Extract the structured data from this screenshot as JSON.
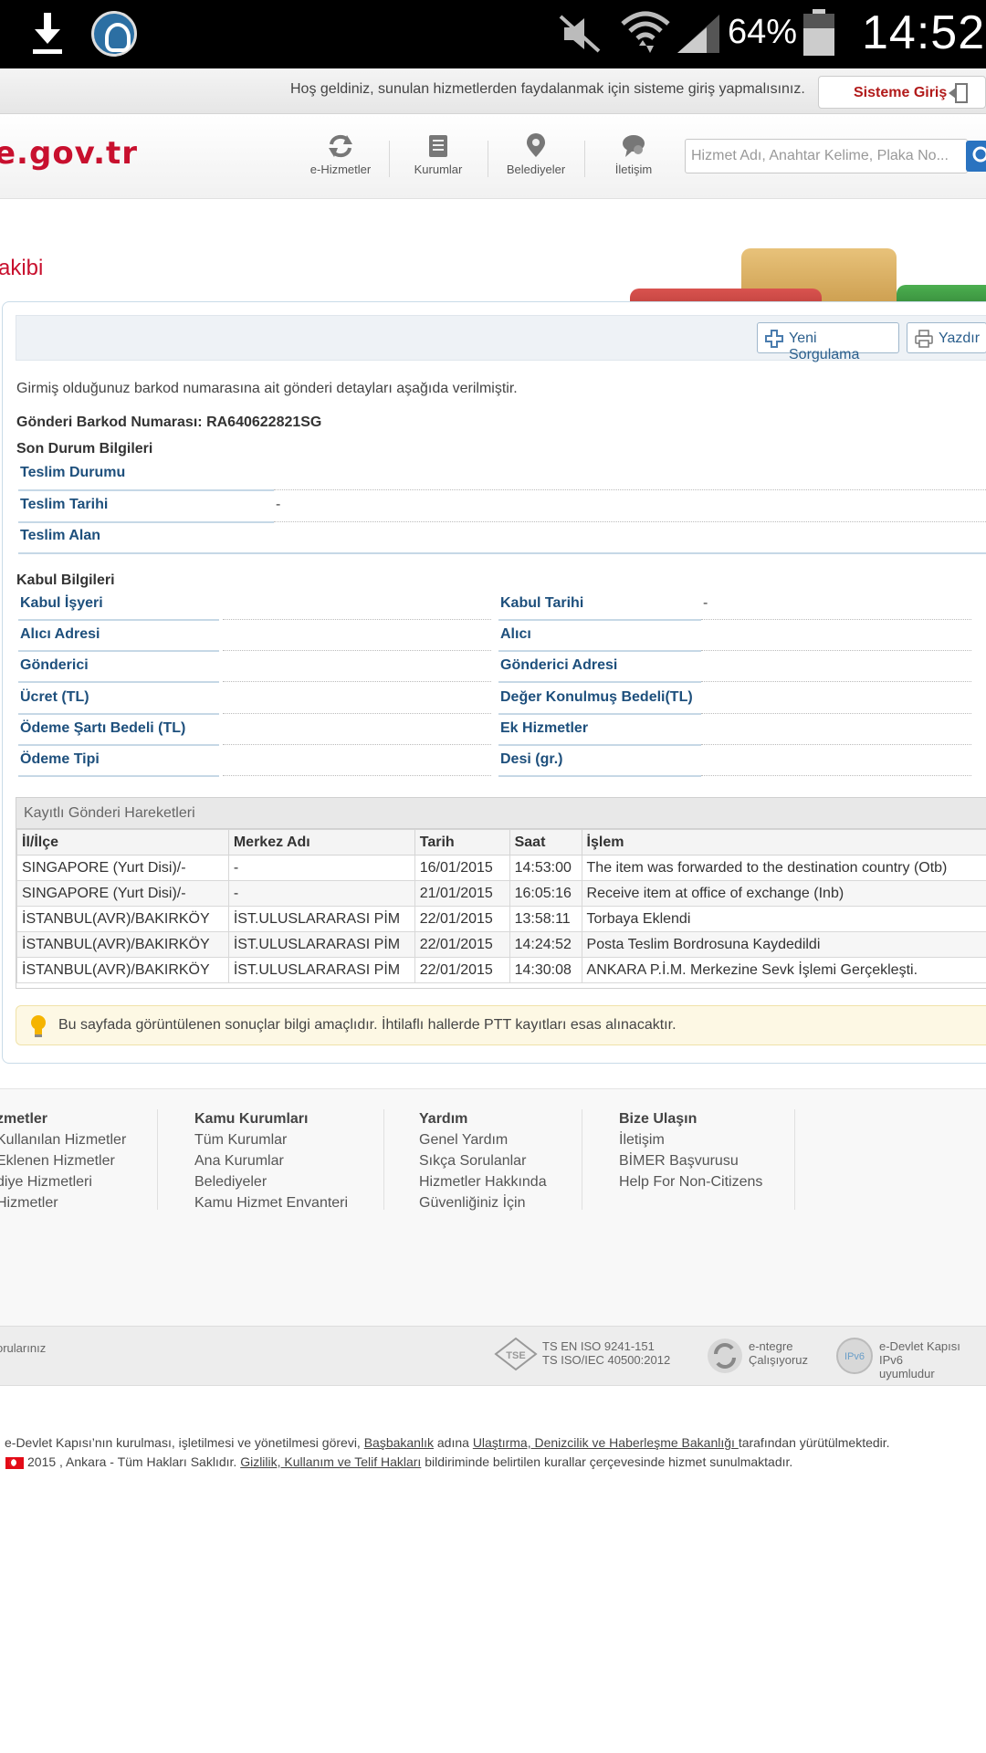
{
  "status_bar": {
    "battery_percent": "64%",
    "time": "14:52"
  },
  "welcome": {
    "text": "Hoş geldiniz, sunulan hizmetlerden faydalanmak için sisteme giriş yapmalısınız.",
    "login_label": "Sisteme Giriş"
  },
  "header": {
    "logo_text": "e.gov.tr",
    "nav": [
      "e-Hizmetler",
      "Kurumlar",
      "Belediyeler",
      "İletişim"
    ],
    "search_placeholder": "Hizmet Adı, Anahtar Kelime, Plaka No..."
  },
  "page": {
    "title": "akibi"
  },
  "toolbar": {
    "new_query_label": "Yeni Sorgulama",
    "print_label": "Yazdır"
  },
  "details": {
    "intro": "Girmiş olduğunuz barkod numarasına ait gönderi detayları aşağıda verilmiştir.",
    "barcode_label": "Gönderi Barkod Numarası:",
    "barcode_value": "RA640622821SG",
    "last_status_title": "Son Durum Bilgileri",
    "last_status": [
      {
        "label": "Teslim Durumu",
        "value": ""
      },
      {
        "label": "Teslim Tarihi",
        "value": "-"
      },
      {
        "label": "Teslim Alan",
        "value": ""
      }
    ],
    "acceptance_title": "Kabul Bilgileri",
    "acceptance_left": [
      {
        "label": "Kabul İşyeri",
        "value": ""
      },
      {
        "label": "Alıcı Adresi",
        "value": ""
      },
      {
        "label": "Gönderici",
        "value": ""
      },
      {
        "label": "Ücret (TL)",
        "value": ""
      },
      {
        "label": "Ödeme Şartı Bedeli (TL)",
        "value": ""
      },
      {
        "label": "Ödeme Tipi",
        "value": ""
      }
    ],
    "acceptance_right": [
      {
        "label": "Kabul Tarihi",
        "value": "-"
      },
      {
        "label": "Alıcı",
        "value": ""
      },
      {
        "label": "Gönderici Adresi",
        "value": ""
      },
      {
        "label": "Değer Konulmuş Bedeli(TL)",
        "value": ""
      },
      {
        "label": "Ek Hizmetler",
        "value": ""
      },
      {
        "label": "Desi (gr.)",
        "value": ""
      }
    ]
  },
  "movements": {
    "title": "Kayıtlı Gönderi Hareketleri",
    "columns": [
      "İl/İlçe",
      "Merkez Adı",
      "Tarih",
      "Saat",
      "İşlem"
    ],
    "rows": [
      [
        "SINGAPORE (Yurt Disi)/-",
        "-",
        "16/01/2015",
        "14:53:00",
        "The item was forwarded to the destination country (Otb)"
      ],
      [
        "SINGAPORE (Yurt Disi)/-",
        "-",
        "21/01/2015",
        "16:05:16",
        "Receive item at office of exchange (Inb)"
      ],
      [
        "İSTANBUL(AVR)/BAKIRKÖY",
        "İST.ULUSLARARASI PİM",
        "22/01/2015",
        "13:58:11",
        "Torbaya Eklendi"
      ],
      [
        "İSTANBUL(AVR)/BAKIRKÖY",
        "İST.ULUSLARARASI PİM",
        "22/01/2015",
        "14:24:52",
        "Posta Teslim Bordrosuna Kaydedildi"
      ],
      [
        "İSTANBUL(AVR)/BAKIRKÖY",
        "İST.ULUSLARARASI PİM",
        "22/01/2015",
        "14:30:08",
        "ANKARA P.İ.M. Merkezine Sevk İşlemi Gerçekleşti."
      ]
    ]
  },
  "notice": "Bu sayfada görüntülenen sonuçlar bilgi amaçlıdır. İhtilaflı hallerde PTT kayıtları esas alınacaktır.",
  "footer": {
    "columns": [
      {
        "title": "zmetler",
        "links": [
          "Kullanılan Hizmetler",
          "Eklenen Hizmetler",
          "diye Hizmetleri",
          "Hizmetler"
        ]
      },
      {
        "title": "Kamu Kurumları",
        "links": [
          "Tüm Kurumlar",
          "Ana Kurumlar",
          "Belediyeler",
          "Kamu Hizmet Envanteri"
        ]
      },
      {
        "title": "Yardım",
        "links": [
          "Genel Yardım",
          "Sıkça Sorulanlar",
          "Hizmetler Hakkında",
          "Güvenliğiniz İçin"
        ]
      },
      {
        "title": "Bize Ulaşın",
        "links": [
          "İletişim",
          "BİMER Başvurusu",
          "Help For Non-Citizens"
        ]
      }
    ]
  },
  "certs": {
    "left_text": "orularınız",
    "iso_line1": "TS EN ISO 9241-151",
    "iso_line2": "TS ISO/IEC 40500:2012",
    "tse_logo": "TSE",
    "entegre_line1": "e-ntegre",
    "entegre_line2": "Çalışıyoruz",
    "ipv6_logo": "IPv6",
    "ipv6_line1": "e-Devlet Kapısı IPv6",
    "ipv6_line2": "uyumludur"
  },
  "legal": {
    "line1_a": "e-Devlet Kapısı’nın kurulması, işletilmesi ve yönetilmesi görevi, ",
    "line1_link1": "Başbakanlık",
    "line1_b": " adına ",
    "line1_link2": "Ulaştırma, Denizcilik ve Haberleşme Bakanlığı ",
    "line1_c": "tarafından yürütülmektedir.",
    "line2_a": "2015 , Ankara - Tüm Hakları Saklıdır. ",
    "line2_link": "Gizlilik, Kullanım ve Telif Hakları",
    "line2_b": " bildiriminde belirtilen kurallar çerçevesinde hizmet sunulmaktadır."
  }
}
